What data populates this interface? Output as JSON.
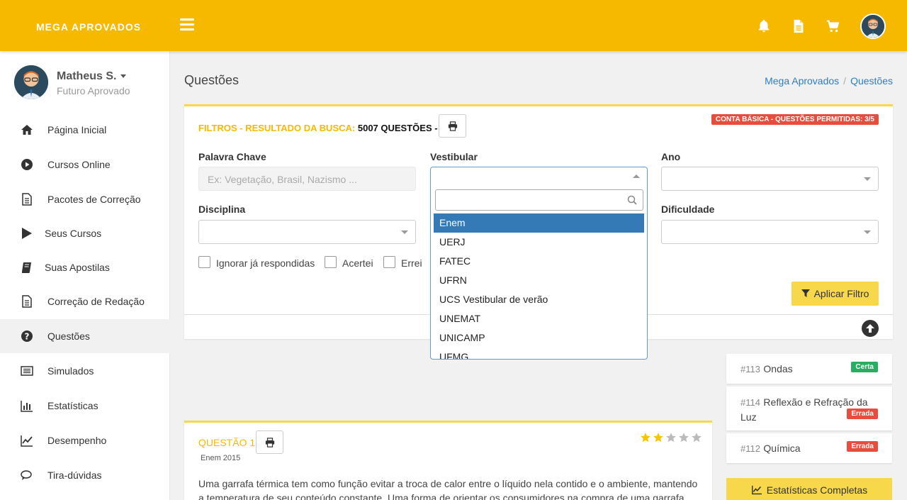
{
  "topbar": {
    "brand": "MEGA APROVADOS",
    "icons": [
      "menu-icon",
      "bell-icon",
      "document-icon",
      "cart-icon",
      "avatar"
    ],
    "accent_color": "#f7b900"
  },
  "user": {
    "name": "Matheus S.",
    "role": "Futuro Aprovado"
  },
  "sidebar": {
    "items": [
      {
        "label": "Página Inicial",
        "icon": "home-icon"
      },
      {
        "label": "Cursos Online",
        "icon": "play-circle-icon"
      },
      {
        "label": "Pacotes de Correção",
        "icon": "file-icon"
      },
      {
        "label": "Seus Cursos",
        "icon": "play-icon"
      },
      {
        "label": "Suas Apostilas",
        "icon": "book-icon"
      },
      {
        "label": "Correção de Redação",
        "icon": "file-icon"
      },
      {
        "label": "Questões",
        "icon": "question-circle-icon",
        "active": true
      },
      {
        "label": "Simulados",
        "icon": "list-icon"
      },
      {
        "label": "Estatísticas",
        "icon": "bar-chart-icon"
      },
      {
        "label": "Desempenho",
        "icon": "line-chart-icon"
      },
      {
        "label": "Tira-dúvidas",
        "icon": "comments-icon"
      }
    ]
  },
  "page": {
    "title": "Questões",
    "breadcrumb": [
      "Mega Aprovados",
      "/",
      "Questões"
    ]
  },
  "filters": {
    "title_prefix": "FILTROS - RESULTADO DA BUSCA:",
    "title_count": "5007 QUESTÕES -",
    "account_badge": "CONTA BÁSICA - QUESTÕES PERMITIDAS: 3/5",
    "keyword_label": "Palavra Chave",
    "keyword_placeholder": "Ex: Vegetação, Brasil, Nazismo ...",
    "vestibular_label": "Vestibular",
    "ano_label": "Ano",
    "disciplina_label": "Disciplina",
    "dificuldade_label": "Dificuldade",
    "checkboxes": [
      "Ignorar já respondidas",
      "Acertei",
      "Errei"
    ],
    "apply_label": "Aplicar Filtro"
  },
  "dropdown": {
    "search_value": "",
    "options": [
      "Enem",
      "UERJ",
      "FATEC",
      "UFRN",
      "UCS Vestibular de verão",
      "UNEMAT",
      "UNICAMP",
      "UFMG"
    ],
    "highlighted": "Enem"
  },
  "question": {
    "title": "QUESTÃO 1",
    "source": "Enem 2015",
    "rating": 2,
    "rating_max": 5,
    "text": "Uma garrafa térmica tem como função evitar a troca de calor entre o líquido nela contido e o ambiente, mantendo a temperatura de seu conteúdo constante. Uma forma de orientar os consumidores na compra de uma garrafa"
  },
  "recent": [
    {
      "num": "#113",
      "topic": "Ondas",
      "status": "Certa"
    },
    {
      "num": "#114",
      "topic": "Reflexão e Refração da Luz",
      "status": "Errada"
    },
    {
      "num": "#112",
      "topic": "Química",
      "status": "Errada"
    }
  ],
  "stats_button": "Estatísticas Completas"
}
